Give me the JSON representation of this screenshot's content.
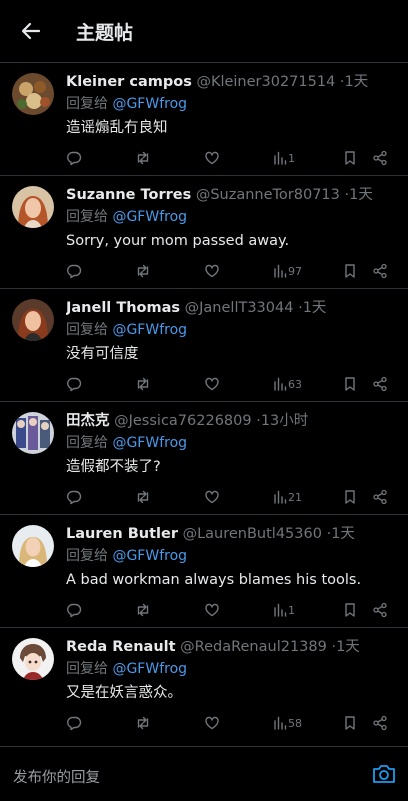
{
  "header": {
    "title": "主题帖"
  },
  "tweets": [
    {
      "name": "Kleiner campos",
      "handle": "@Kleiner30271514",
      "time": "1天",
      "reply_prefix": "回复给",
      "reply_to": "@GFWfrog",
      "text": "造谣煽乱冇良知",
      "views": "1"
    },
    {
      "name": "Suzanne Torres",
      "handle": "@SuzanneTor80713",
      "time": "1天",
      "reply_prefix": "回复给",
      "reply_to": "@GFWfrog",
      "text": "Sorry, your mom passed away.",
      "views": "97"
    },
    {
      "name": "Janell Thomas",
      "handle": "@JanellT33044",
      "time": "1天",
      "reply_prefix": "回复给",
      "reply_to": "@GFWfrog",
      "text": "没有可信度",
      "views": "63"
    },
    {
      "name": "田杰克",
      "handle": "@Jessica76226809",
      "time": "13小时",
      "reply_prefix": "回复给",
      "reply_to": "@GFWfrog",
      "text": "造假都不装了?",
      "views": "21"
    },
    {
      "name": "Lauren Butler",
      "handle": "@LaurenButl45360",
      "time": "1天",
      "reply_prefix": "回复给",
      "reply_to": "@GFWfrog",
      "text": "A bad workman always blames his tools.",
      "views": "1"
    },
    {
      "name": "Reda Renault",
      "handle": "@RedaRenaul21389",
      "time": "1天",
      "reply_prefix": "回复给",
      "reply_to": "@GFWfrog",
      "text": "又是在妖言惑众。",
      "views": "58"
    }
  ],
  "composer": {
    "placeholder": "发布你的回复"
  },
  "colors": {
    "background": "#000000",
    "text": "#e7e9ea",
    "muted": "#71767b",
    "link": "#4a99e9",
    "divider": "#2f3336"
  }
}
